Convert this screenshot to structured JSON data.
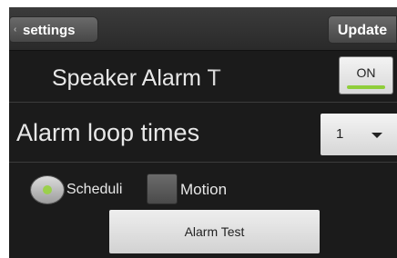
{
  "topbar": {
    "back_label": "settings",
    "update_label": "Update"
  },
  "speaker_alarm": {
    "label": "Speaker Alarm T",
    "toggle_state": "ON",
    "toggle_accent": "#8fce3a"
  },
  "alarm_loop": {
    "label": "Alarm loop times",
    "value": "1"
  },
  "options": {
    "schedule_label": "Scheduli",
    "schedule_selected": true,
    "motion_label": "Motion",
    "motion_checked": false
  },
  "alarm_test_label": "Alarm Test",
  "colors": {
    "background": "#1b1b1b",
    "button_face": "#e6e6e6",
    "accent_green": "#8fce3a"
  },
  "icons": [
    "back-arrow-icon",
    "dropdown-arrow-icon"
  ]
}
